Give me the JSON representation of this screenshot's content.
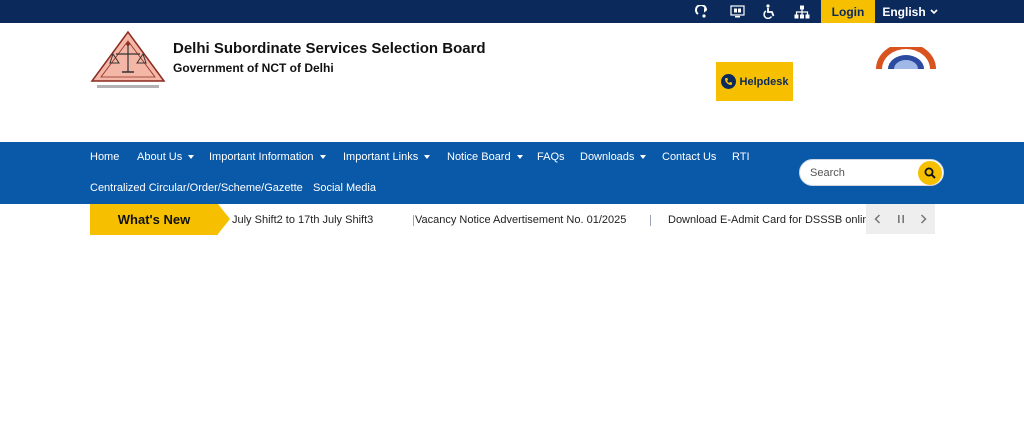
{
  "topbar": {
    "icons": [
      "screen-reader-icon",
      "text-size-icon",
      "accessibility-icon",
      "sitemap-icon"
    ],
    "login_label": "Login",
    "language_label": "English",
    "colors": {
      "background": "#0b2a5b",
      "accent": "#f6c000"
    }
  },
  "header": {
    "org_name": "Delhi Subordinate Services Selection Board",
    "org_subtitle": "Government of NCT of Delhi",
    "helpdesk_label": "Helpdesk"
  },
  "nav": {
    "items": [
      {
        "label": "Home",
        "dropdown": false
      },
      {
        "label": "About Us",
        "dropdown": true
      },
      {
        "label": "Important Information",
        "dropdown": true
      },
      {
        "label": "Important Links",
        "dropdown": true
      },
      {
        "label": "Notice Board",
        "dropdown": true
      },
      {
        "label": "FAQs",
        "dropdown": false
      },
      {
        "label": "Downloads",
        "dropdown": true
      },
      {
        "label": "Contact Us",
        "dropdown": false
      },
      {
        "label": "RTI",
        "dropdown": false
      },
      {
        "label": "Centralized Circular/Order/Scheme/Gazette",
        "dropdown": false
      },
      {
        "label": "Social Media",
        "dropdown": false
      }
    ],
    "colors": {
      "background": "#0a58a8"
    }
  },
  "search": {
    "placeholder": "Search"
  },
  "whats_new": {
    "label": "What's New",
    "items": [
      "July Shift2 to 17th July Shift3",
      "Vacancy Notice Advertisement No. 01/2025",
      "Download E-Admit Card for DSSSB online e"
    ]
  }
}
